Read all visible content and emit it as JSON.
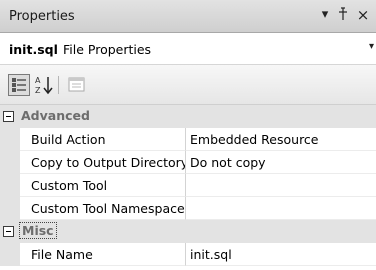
{
  "window": {
    "title": "Properties",
    "buttons": {
      "dropdown": "▾",
      "pin": "ᚁ",
      "close": "×"
    }
  },
  "object_selector": {
    "name": "init.sql",
    "type": "File Properties",
    "dropdown": "▾"
  },
  "toolbar": {
    "buttons": [
      "categorized-icon",
      "alphabetical-icon",
      "property-pages-icon"
    ]
  },
  "grid": {
    "categories": [
      {
        "name": "Advanced",
        "expanded": true,
        "properties": [
          {
            "label": "Build Action",
            "value": "Embedded Resource"
          },
          {
            "label": "Copy to Output Directory",
            "value": "Do not copy"
          },
          {
            "label": "Custom Tool",
            "value": ""
          },
          {
            "label": "Custom Tool Namespace",
            "value": ""
          }
        ]
      },
      {
        "name": "Misc",
        "expanded": true,
        "properties": [
          {
            "label": "File Name",
            "value": "init.sql"
          }
        ]
      }
    ]
  }
}
